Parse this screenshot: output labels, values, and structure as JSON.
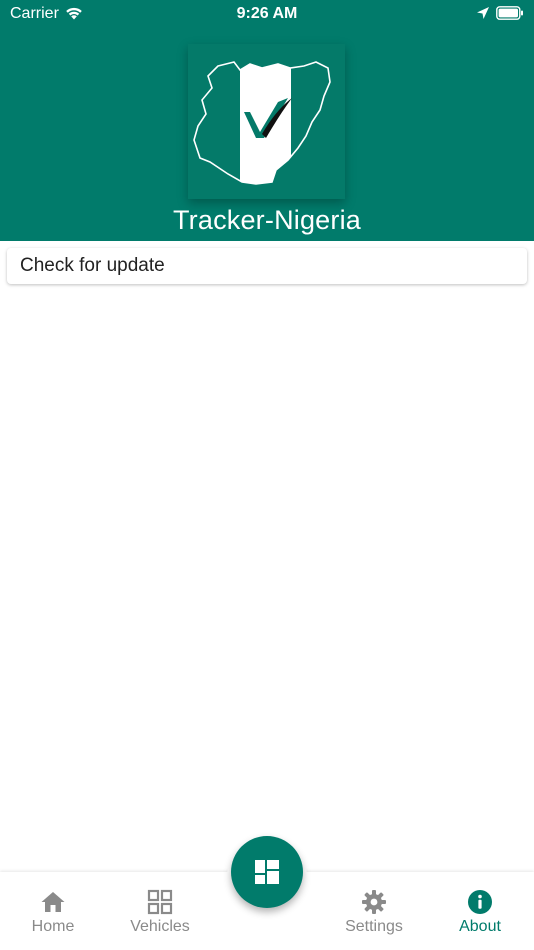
{
  "status_bar": {
    "carrier": "Carrier",
    "time": "9:26 AM"
  },
  "header": {
    "app_title": "Tracker-Nigeria",
    "background_color": "#017b6b"
  },
  "main": {
    "check_update_label": "Check for update"
  },
  "bottom_nav": {
    "items": [
      {
        "label": "Home",
        "icon": "home-icon"
      },
      {
        "label": "Vehicles",
        "icon": "grid-icon"
      },
      {
        "label": "Settings",
        "icon": "gear-icon"
      },
      {
        "label": "About",
        "icon": "info-icon",
        "active": true
      }
    ],
    "fab_icon": "dashboard-icon",
    "active_color": "#017b6b",
    "inactive_color": "#8a8a8a"
  }
}
